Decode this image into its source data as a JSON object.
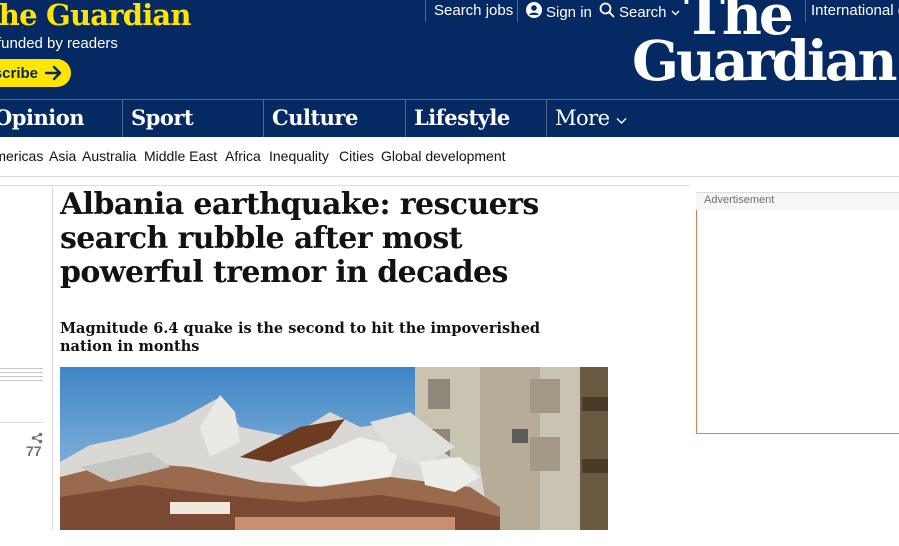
{
  "masthead": {
    "support_title": "The Guardian",
    "support_subtitle": "funded by readers",
    "subscribe_label": "Subscribe",
    "top_links": {
      "search_jobs": "Search jobs",
      "sign_in": "Sign in",
      "search": "Search",
      "edition": "International edition"
    },
    "logo_line1": "The",
    "logo_line2": "Guardian"
  },
  "pillars": [
    "Opinion",
    "Sport",
    "Culture",
    "Lifestyle"
  ],
  "more_label": "More",
  "subnav": [
    "Americas",
    "Asia",
    "Australia",
    "Middle East",
    "Africa",
    "Inequality",
    "Cities",
    "Global development"
  ],
  "article": {
    "headline": "Albania earthquake: rescuers search rubble after most powerful tremor in decades",
    "standfirst": "Magnitude 6.4 quake is the second to hit the impoverished nation in months",
    "share_count": "77"
  },
  "ad": {
    "label": "Advertisement"
  },
  "colors": {
    "brand_blue": "#052962",
    "brand_yellow": "#ffe500",
    "ad_border": "#e37c5a"
  },
  "icons": [
    "arrow-right-icon",
    "user-icon",
    "search-icon",
    "chevron-down-icon",
    "share-icon"
  ]
}
